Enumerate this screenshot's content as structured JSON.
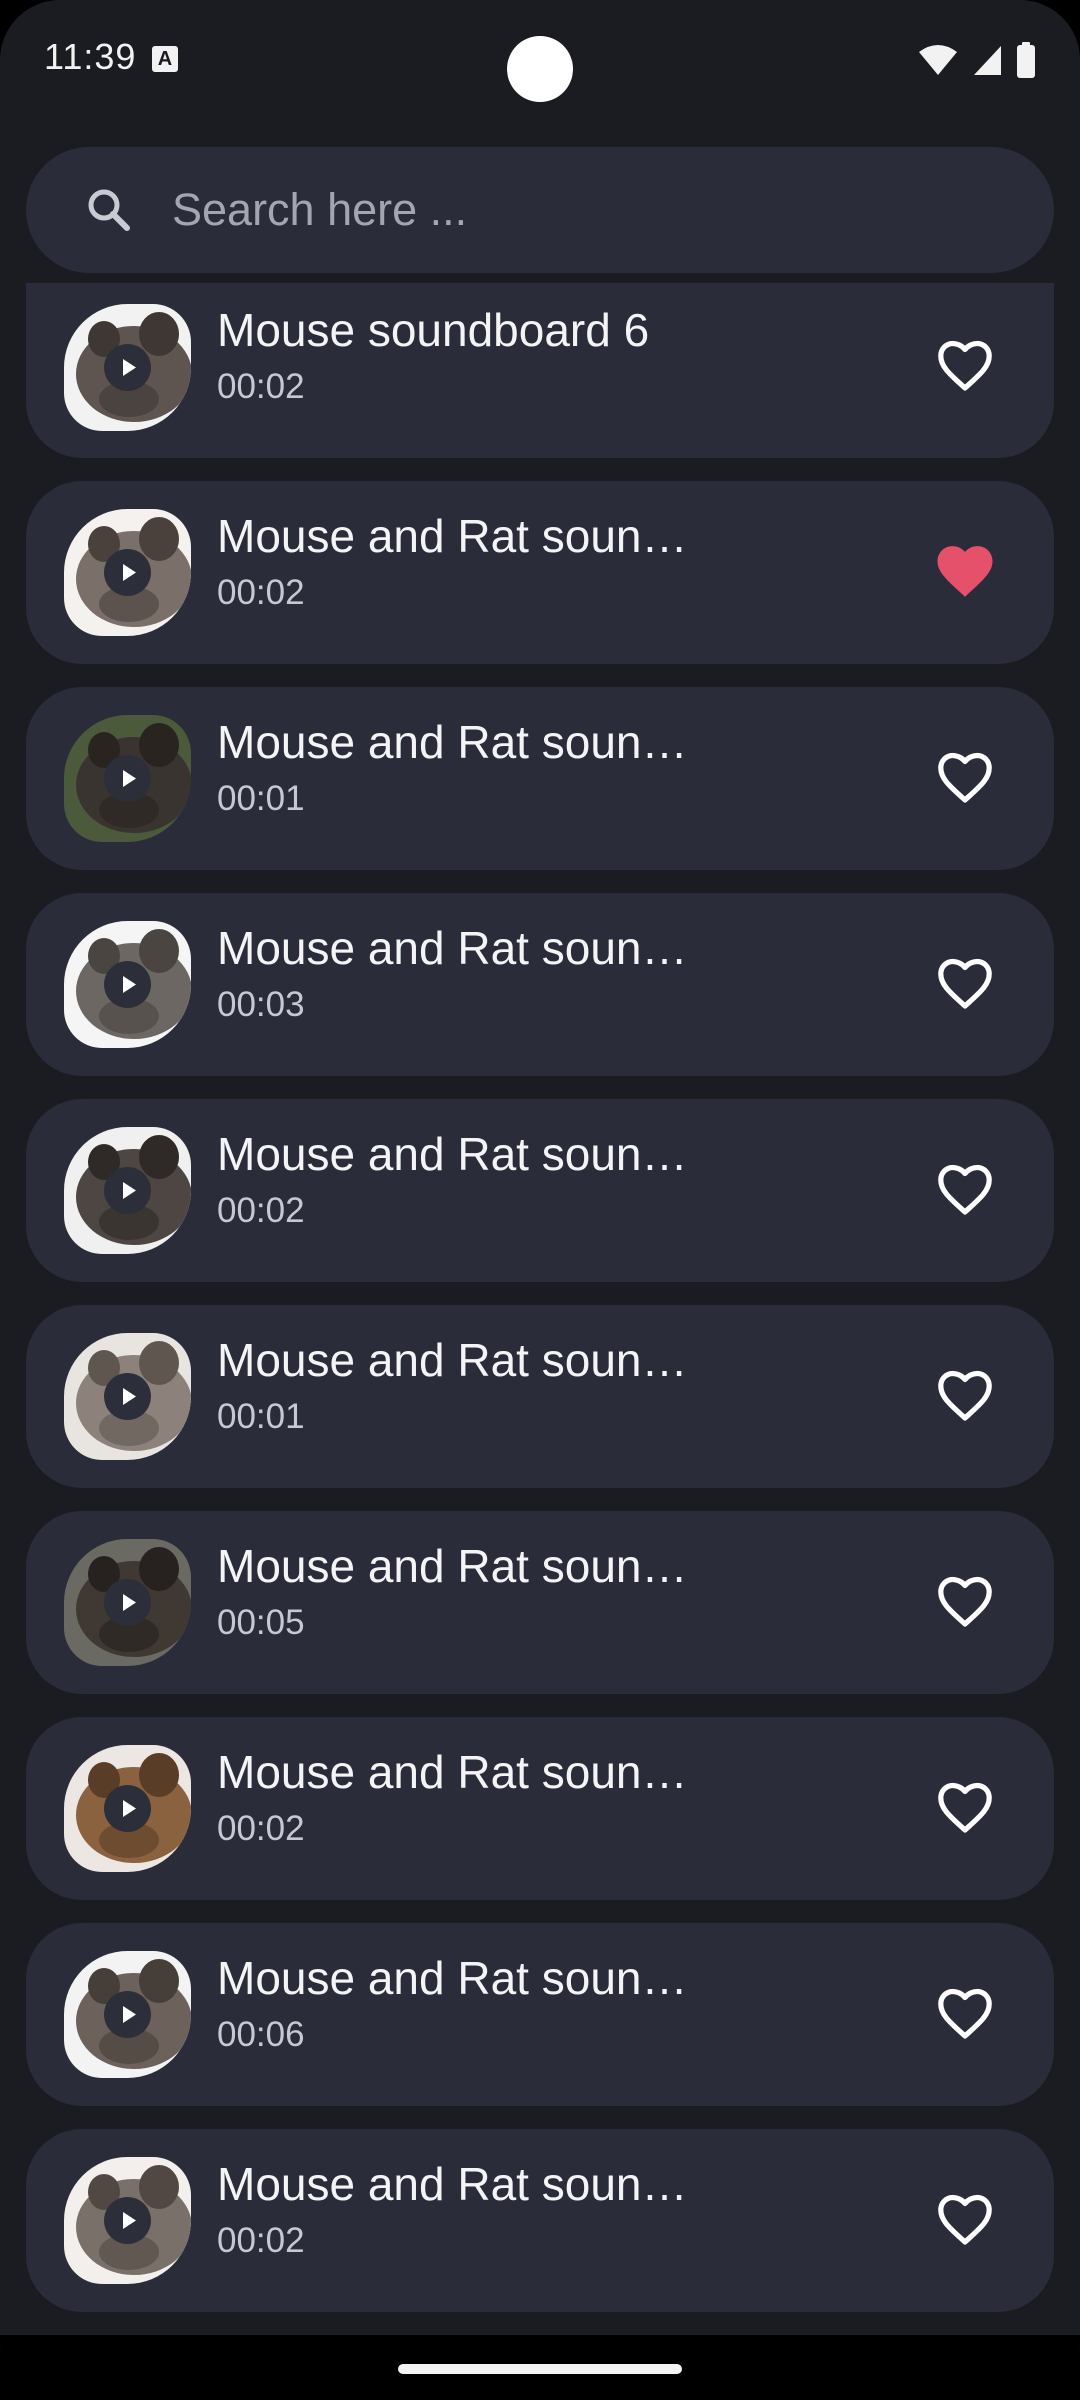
{
  "status_bar": {
    "time": "11:39",
    "a_icon_letter": "A",
    "icons": [
      "wifi-icon",
      "cellular-signal-icon",
      "battery-icon"
    ]
  },
  "search": {
    "placeholder": "Search here ...",
    "value": "",
    "icon": "search-icon"
  },
  "sounds": [
    {
      "title": "Mouse soundboard 6",
      "duration": "00:02",
      "favorite": false
    },
    {
      "title": "Mouse and Rat soun…",
      "duration": "00:02",
      "favorite": true
    },
    {
      "title": "Mouse and Rat soun…",
      "duration": "00:01",
      "favorite": false
    },
    {
      "title": "Mouse and Rat soun…",
      "duration": "00:03",
      "favorite": false
    },
    {
      "title": "Mouse and Rat soun…",
      "duration": "00:02",
      "favorite": false
    },
    {
      "title": "Mouse and Rat soun…",
      "duration": "00:01",
      "favorite": false
    },
    {
      "title": "Mouse and Rat soun…",
      "duration": "00:05",
      "favorite": false
    },
    {
      "title": "Mouse and Rat soun…",
      "duration": "00:02",
      "favorite": false
    },
    {
      "title": "Mouse and Rat soun…",
      "duration": "00:06",
      "favorite": false
    },
    {
      "title": "Mouse and Rat soun…",
      "duration": "00:02",
      "favorite": false
    }
  ],
  "colors": {
    "background": "#1b1c22",
    "card": "#2a2d39",
    "favorite_active": "#e5516b",
    "text_primary": "#f4f4f6",
    "text_secondary": "#c6c8d2"
  }
}
